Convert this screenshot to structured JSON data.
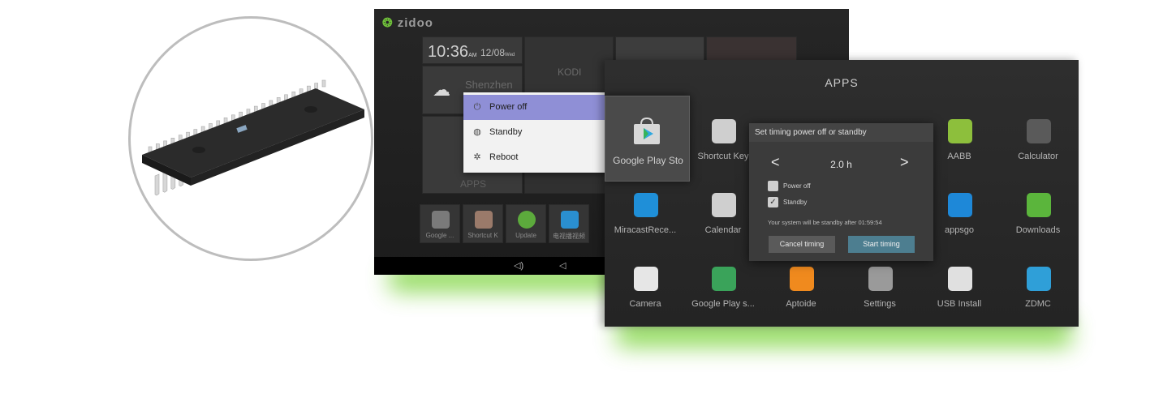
{
  "back_screen": {
    "logo": "zidoo",
    "clock": {
      "time": "10:36",
      "ampm": "AM",
      "date": "12/08",
      "weekday": "Wed"
    },
    "weather_city": "Shenzhen",
    "kodi_label": "KODI",
    "apps_label": "APPS",
    "bottom_apps": [
      {
        "label": "Google ...",
        "icon": "play-store-icon",
        "color": "#7a7a7a"
      },
      {
        "label": "Shortcut K",
        "icon": "shortcut-icon",
        "color": "#9a7a6a"
      },
      {
        "label": "Update",
        "icon": "update-icon",
        "color": "#5caa3c"
      },
      {
        "label": "电视播视频",
        "icon": "video-icon",
        "color": "#2a8fd0"
      }
    ],
    "power_menu": {
      "items": [
        {
          "label": "Power off",
          "icon": "⏻",
          "selected": true
        },
        {
          "label": "Standby",
          "icon": "◍",
          "selected": false
        },
        {
          "label": "Reboot",
          "icon": "✲",
          "selected": false
        }
      ]
    }
  },
  "front_screen": {
    "title": "APPS",
    "focused_app": "Google Play Sto",
    "apps_row1": [
      {
        "label": "Shortcut Key",
        "icon": "shortcut-key-icon",
        "color": "#cfcfcf"
      },
      {
        "label": "AABB",
        "icon": "android-icon",
        "color": "#8dbf3c"
      },
      {
        "label": "Calculator",
        "icon": "calculator-icon",
        "color": "#5a5a5a"
      }
    ],
    "apps_row2": [
      {
        "label": "MiracastRece...",
        "icon": "miracast-icon",
        "color": "#1f8fd8"
      },
      {
        "label": "Calendar",
        "icon": "calendar-icon",
        "color": "#cfcfcf"
      },
      {
        "label": "appsgo",
        "icon": "appsgo-icon",
        "color": "#1e88d8"
      },
      {
        "label": "Downloads",
        "icon": "downloads-icon",
        "color": "#5bb53c"
      }
    ],
    "apps_row3": [
      {
        "label": "Camera",
        "icon": "camera-icon",
        "color": "#e6e6e6"
      },
      {
        "label": "Google Play s...",
        "icon": "google-play-services-icon",
        "color": "#3aa35a"
      },
      {
        "label": "Aptoide",
        "icon": "aptoide-icon",
        "color": "#f08a1e"
      },
      {
        "label": "Settings",
        "icon": "settings-icon",
        "color": "#9a9a9a"
      },
      {
        "label": "USB Install",
        "icon": "usb-install-icon",
        "color": "#e0e0e0"
      },
      {
        "label": "ZDMC",
        "icon": "zdmc-icon",
        "color": "#2f9fd8"
      }
    ],
    "timing_dialog": {
      "title": "Set timing power off or standby",
      "value": "2.0  h",
      "prev": "<",
      "next": ">",
      "options": [
        {
          "label": "Power off",
          "checked": false
        },
        {
          "label": "Standby",
          "checked": true
        }
      ],
      "note": "Your system will be standby after   01:59:54",
      "cancel_label": "Cancel timing",
      "start_label": "Start timing"
    }
  },
  "colors": {
    "menu_highlight": "#8f8fd6",
    "start_button": "#4d7e90",
    "glow": "#6fcf2a"
  }
}
